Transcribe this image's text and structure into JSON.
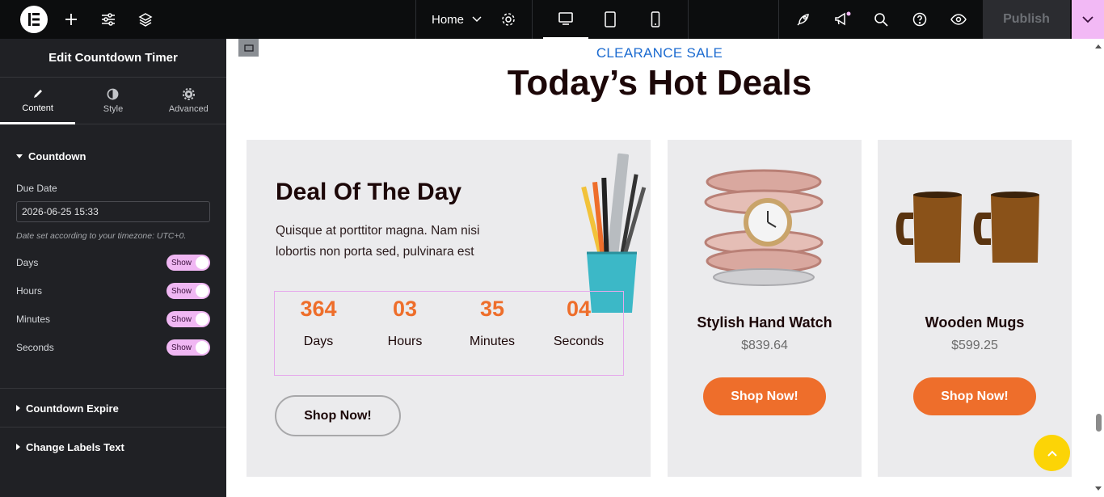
{
  "topbar": {
    "page_menu_label": "Home",
    "publish_label": "Publish",
    "icons": [
      "elementor-logo-icon",
      "add-icon",
      "sliders-icon",
      "layers-icon",
      "chevron-down-icon",
      "gear-icon",
      "desktop-icon",
      "tablet-icon",
      "mobile-icon",
      "rocket-icon",
      "megaphone-icon",
      "search-icon",
      "help-icon",
      "eye-icon",
      "chevron-down-icon"
    ],
    "colors": {
      "background": "#0c0d0e",
      "publish_dropdown": "#f2b9f5"
    }
  },
  "panel": {
    "title": "Edit Countdown Timer",
    "tabs": [
      {
        "label": "Content",
        "icon": "pencil-icon",
        "active": true
      },
      {
        "label": "Style",
        "icon": "half-circle-icon",
        "active": false
      },
      {
        "label": "Advanced",
        "icon": "gear-icon",
        "active": false
      }
    ],
    "countdown_section": "Countdown",
    "due_date_label": "Due Date",
    "due_date_value": "2026-06-25 15:33",
    "timezone_note": "Date set according to your timezone: UTC+0.",
    "toggles": [
      {
        "label": "Days",
        "state": "Show"
      },
      {
        "label": "Hours",
        "state": "Show"
      },
      {
        "label": "Minutes",
        "state": "Show"
      },
      {
        "label": "Seconds",
        "state": "Show"
      }
    ],
    "expire_section": "Countdown Expire",
    "labels_section": "Change Labels Text"
  },
  "canvas": {
    "eyebrow": "CLEARANCE SALE",
    "heading": "Today’s Hot Deals",
    "deal": {
      "title": "Deal Of The Day",
      "description": "Quisque at porttitor magna. Nam nisi lobortis non porta sed, pulvinara est",
      "countdown": [
        {
          "value": "364",
          "label": "Days"
        },
        {
          "value": "03",
          "label": "Hours"
        },
        {
          "value": "35",
          "label": "Minutes"
        },
        {
          "value": "04",
          "label": "Seconds"
        }
      ],
      "button": "Shop Now!"
    },
    "products": [
      {
        "name": "Stylish Hand Watch",
        "price": "$839.64",
        "button": "Shop Now!"
      },
      {
        "name": "Wooden Mugs",
        "price": "$599.25",
        "button": "Shop Now!"
      }
    ],
    "colors": {
      "accent_orange": "#ee6e2b",
      "eyebrow_blue": "#1c6bd0",
      "scroll_top": "#fcd406"
    }
  }
}
